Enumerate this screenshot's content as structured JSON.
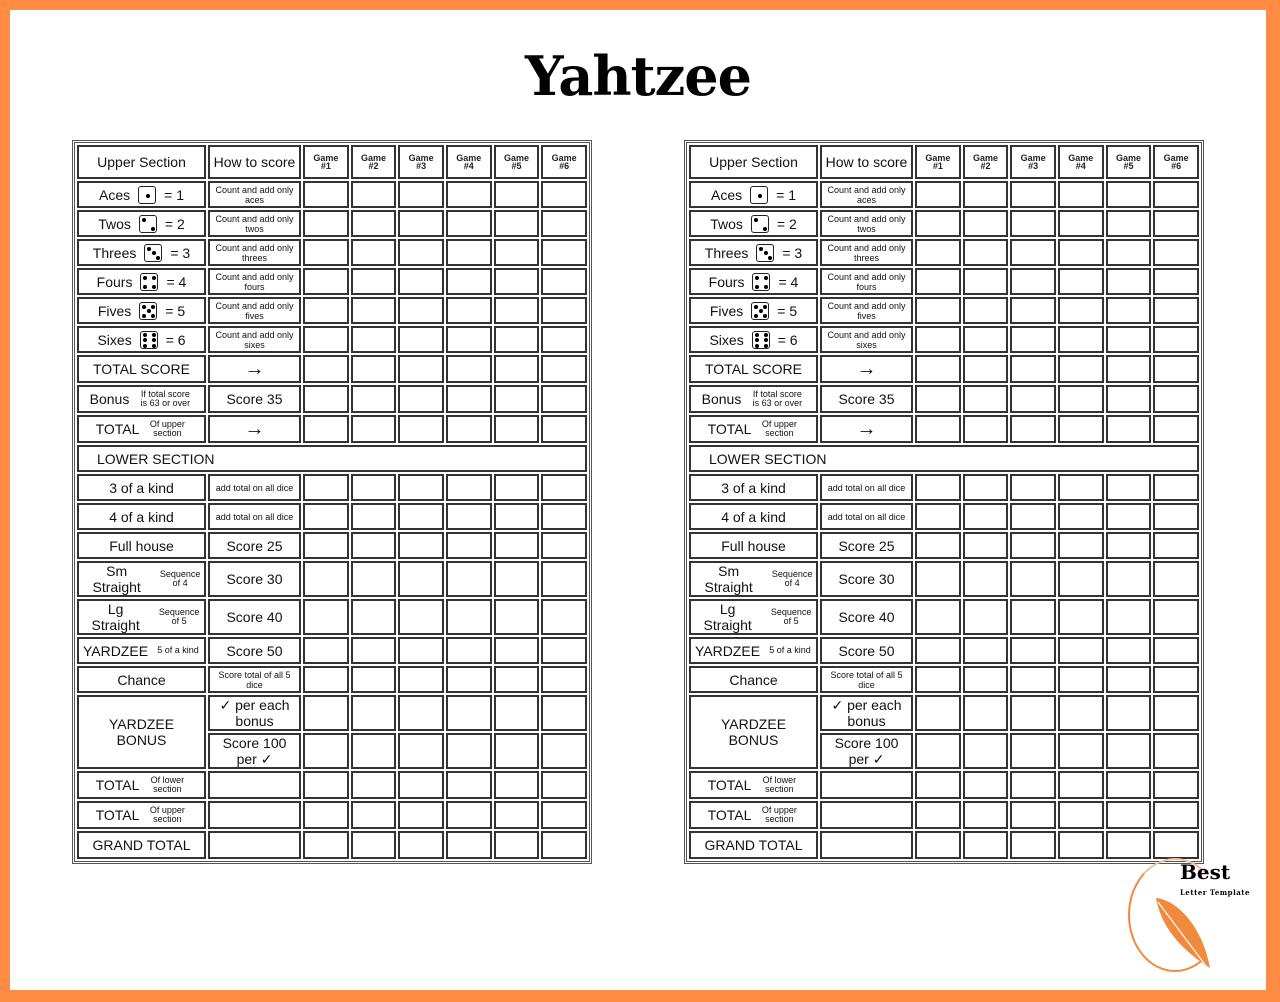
{
  "title": "Yahtzee",
  "colors": {
    "frame": "#ff8c42",
    "logo_accent": "#f08a3c"
  },
  "header": {
    "upper_section": "Upper Section",
    "how_to_score": "How to score",
    "games": [
      {
        "l1": "Game",
        "l2": "#1"
      },
      {
        "l1": "Game",
        "l2": "#2"
      },
      {
        "l1": "Game",
        "l2": "#3"
      },
      {
        "l1": "Game",
        "l2": "#4"
      },
      {
        "l1": "Game",
        "l2": "#5"
      },
      {
        "l1": "Game",
        "l2": "#6"
      }
    ]
  },
  "upper": [
    {
      "name": "Aces",
      "die": "die-one-icon",
      "eq": "= 1",
      "how": "Count and add only aces"
    },
    {
      "name": "Twos",
      "die": "die-two-icon",
      "eq": "= 2",
      "how": "Count and add only twos"
    },
    {
      "name": "Threes",
      "die": "die-three-icon",
      "eq": "= 3",
      "how": "Count and add only threes"
    },
    {
      "name": "Fours",
      "die": "die-four-icon",
      "eq": "= 4",
      "how": "Count and add only fours"
    },
    {
      "name": "Fives",
      "die": "die-five-icon",
      "eq": "= 5",
      "how": "Count and add only fives"
    },
    {
      "name": "Sixes",
      "die": "die-six-icon",
      "eq": "= 6",
      "how": "Count and add only sixes"
    }
  ],
  "upper_totals": {
    "total_score": {
      "label": "TOTAL SCORE",
      "how": "→"
    },
    "bonus": {
      "label": "Bonus",
      "note": "If total score is 63 or over",
      "how": "Score 35"
    },
    "total": {
      "label": "TOTAL",
      "note": "Of upper section",
      "how": "→"
    }
  },
  "lower_section_label": "LOWER SECTION",
  "lower": [
    {
      "name": "3 of a kind",
      "note": "",
      "how": "add total on all dice",
      "how_small": true
    },
    {
      "name": "4 of a kind",
      "note": "",
      "how": "add total on all dice",
      "how_small": true
    },
    {
      "name": "Full house",
      "note": "",
      "how": "Score 25",
      "how_small": false
    },
    {
      "name": "Sm Straight",
      "note": "Sequence of 4",
      "how": "Score 30",
      "how_small": false
    },
    {
      "name": "Lg Straight",
      "note": "Sequence of 5",
      "how": "Score 40",
      "how_small": false
    },
    {
      "name": "YARDZEE",
      "note": "5 of a kind",
      "how": "Score 50",
      "how_small": false
    },
    {
      "name": "Chance",
      "note": "",
      "how": "Score total of all 5 dice",
      "how_small": true
    }
  ],
  "yardzee_bonus": {
    "label_l1": "YARDZEE",
    "label_l2": "BONUS",
    "row1": {
      "check": "✓",
      "text_l1": "per each",
      "text_l2": "bonus"
    },
    "row2": {
      "text_l1": "Score 100",
      "text_l2": "per",
      "check": "✓"
    }
  },
  "totals": [
    {
      "label": "TOTAL",
      "note": "Of lower section"
    },
    {
      "label": "TOTAL",
      "note": "Of upper section"
    },
    {
      "label": "GRAND TOTAL",
      "note": ""
    }
  ],
  "logo": {
    "line1": "Best",
    "line2": "Letter Template"
  }
}
